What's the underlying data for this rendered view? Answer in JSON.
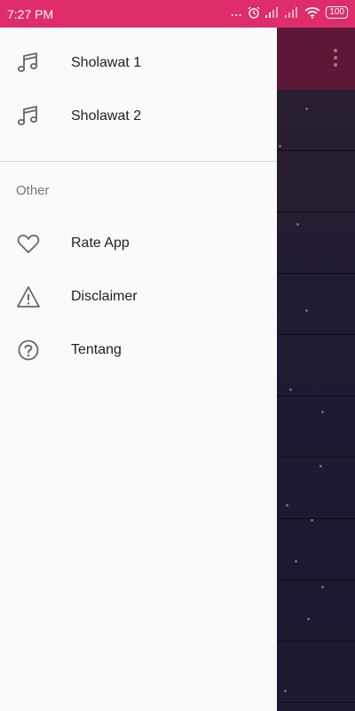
{
  "status_bar": {
    "time": "7:27 PM",
    "dots": "...",
    "battery": "100"
  },
  "drawer": {
    "items": [
      {
        "label": "Sholawat 1",
        "icon": "music-note-icon"
      },
      {
        "label": "Sholawat 2",
        "icon": "music-note-icon"
      }
    ],
    "section_title": "Other",
    "other_items": [
      {
        "label": "Rate App",
        "icon": "heart-icon"
      },
      {
        "label": "Disclaimer",
        "icon": "warning-icon"
      },
      {
        "label": "Tentang",
        "icon": "help-circle-icon"
      }
    ]
  },
  "colors": {
    "status_bar": "#de2d6a",
    "drawer_bg": "#fafafa",
    "text_primary": "#222222",
    "text_secondary": "#777777",
    "icon": "#666666"
  }
}
